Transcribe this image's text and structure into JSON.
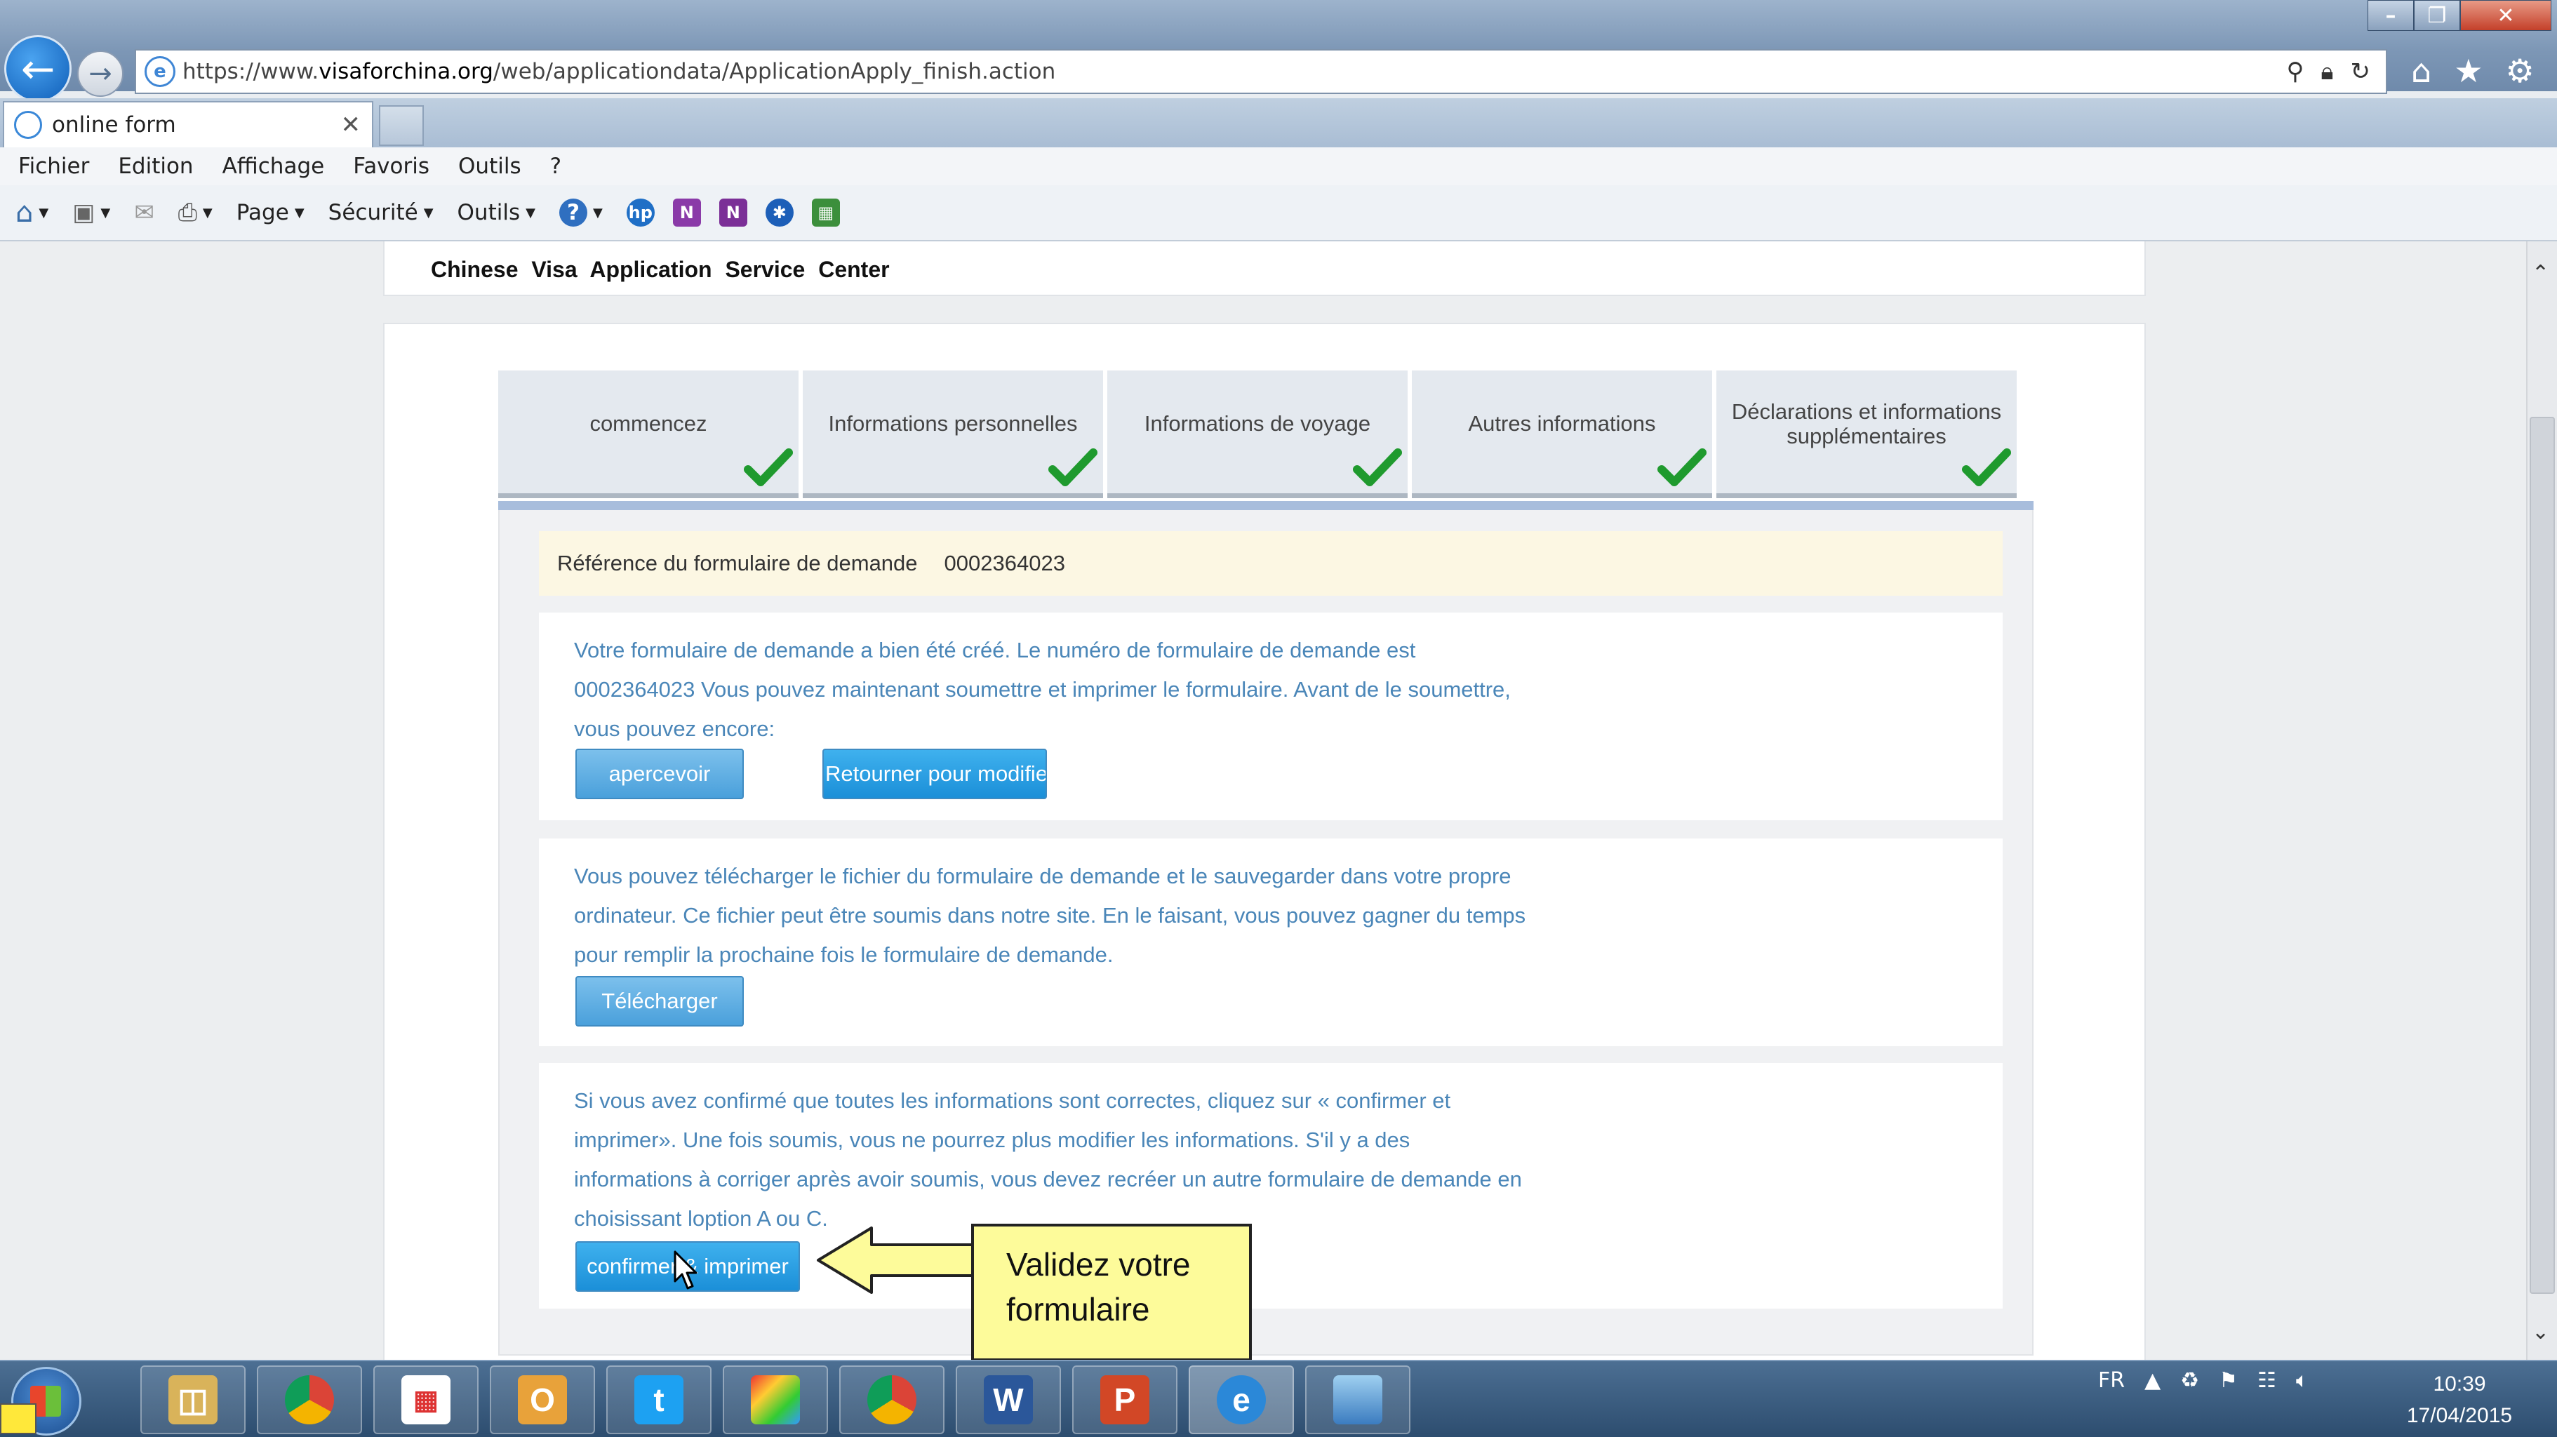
{
  "browser": {
    "url_prefix": "https://www.",
    "url_domain": "visaforchina.org",
    "url_path": "/web/applicationdata/ApplicationApply_finish.action",
    "tab_title": "online form",
    "menu": [
      "Fichier",
      "Edition",
      "Affichage",
      "Favoris",
      "Outils",
      "?"
    ],
    "commands": {
      "page": "Page",
      "security": "Sécurité",
      "tools": "Outils"
    },
    "icons": [
      "back-icon",
      "forward-icon",
      "home-icon",
      "favorites-icon",
      "settings-icon",
      "search-icon",
      "lock-icon",
      "refresh-icon"
    ]
  },
  "site": {
    "logo_text": "Chinese Visa Application Service Center"
  },
  "steps": [
    {
      "label": "commencez",
      "done": true
    },
    {
      "label": "Informations personnelles",
      "done": true
    },
    {
      "label": "Informations de voyage",
      "done": true
    },
    {
      "label": "Autres informations",
      "done": true
    },
    {
      "label": "Déclarations et informations supplémentaires",
      "done": true
    }
  ],
  "reference": {
    "label": "Référence du formulaire de demande",
    "value": "0002364023"
  },
  "section1": {
    "text": "Votre formulaire de demande a bien été créé. Le numéro de formulaire de demande est 0002364023 Vous pouvez maintenant soumettre et imprimer le formulaire. Avant de le soumettre, vous pouvez encore:",
    "btn_preview": "apercevoir",
    "btn_return": "Retourner pour modifier"
  },
  "section2": {
    "text": "Vous pouvez télécharger le fichier du formulaire de demande et le sauvegarder dans votre propre ordinateur. Ce fichier peut être soumis dans notre site. En le faisant, vous pouvez gagner du temps pour remplir la prochaine fois le formulaire de demande.",
    "btn_download": "Télécharger"
  },
  "section3": {
    "text": "Si vous avez confirmé que toutes les informations sont correctes, cliquez sur « confirmer et imprimer». Une fois soumis, vous ne pourrez plus modifier les informations. S'il y a des informations à corriger après avoir soumis, vous devez recréer un autre formulaire de demande en choisissant loption A ou C.",
    "btn_confirm": "confirmer & imprimer"
  },
  "callout": {
    "text": "Validez votre formulaire"
  },
  "taskbar": {
    "language": "FR",
    "time": "10:39",
    "date": "17/04/2015"
  },
  "colors": {
    "accent": "#1b8fd8",
    "check": "#1f9a2e",
    "link_text": "#4a86b8",
    "callout": "#fdfb9a"
  }
}
